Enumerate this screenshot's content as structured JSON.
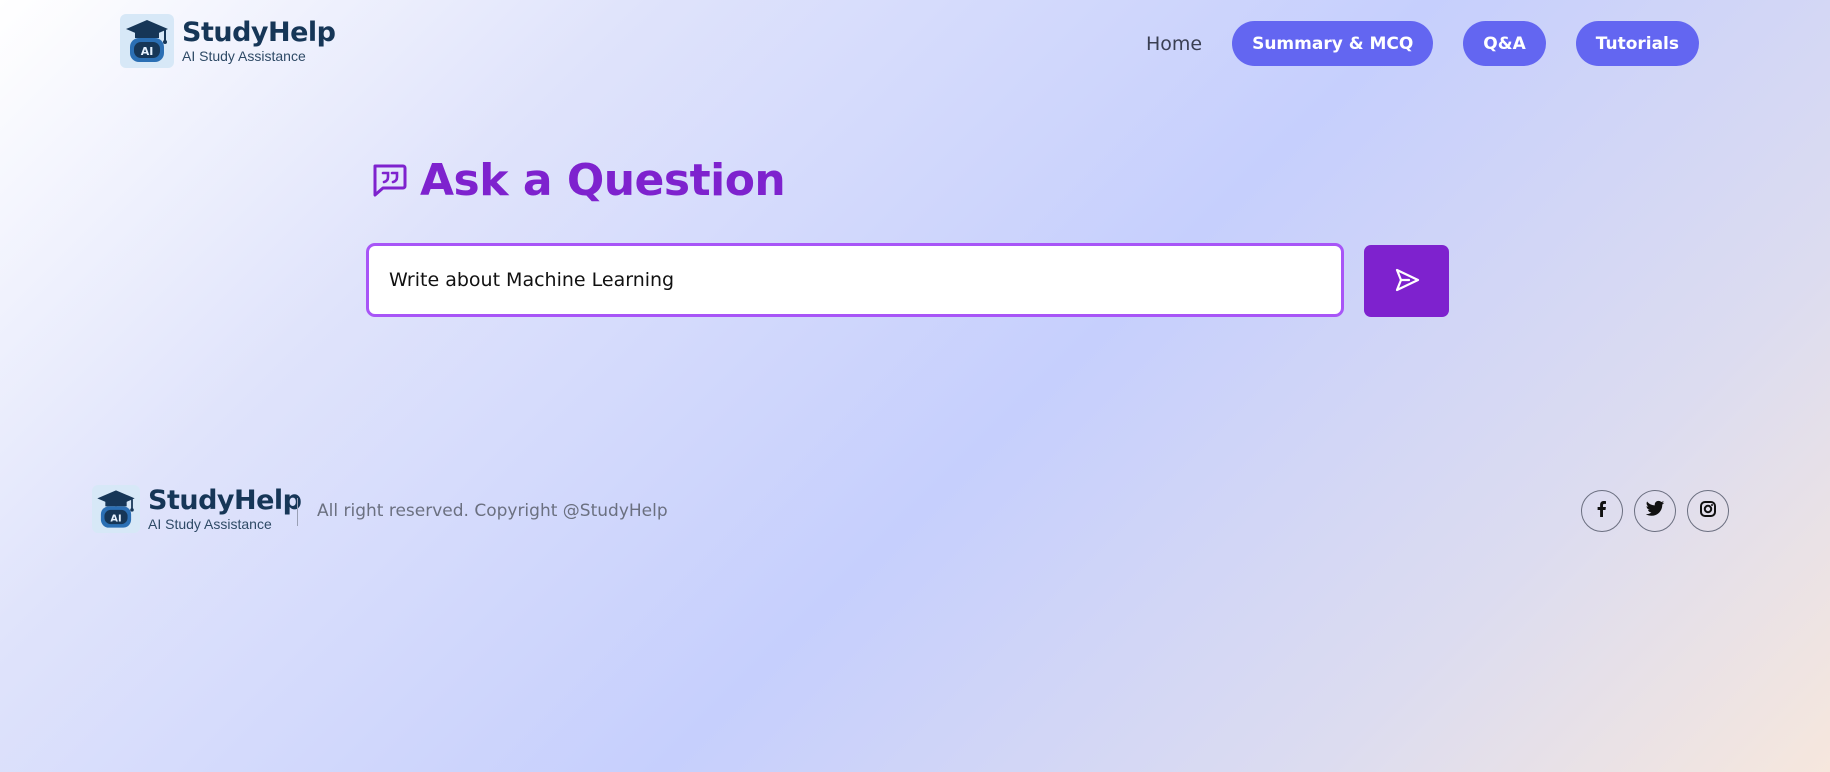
{
  "brand": {
    "name": "StudyHelp",
    "tagline": "AI Study Assistance",
    "badge_text": "AI",
    "icon": "graduation-cap-robot-logo",
    "colors": {
      "name": "#163657",
      "badge_bg": "#d7e8f7"
    }
  },
  "nav": {
    "home": "Home",
    "items": [
      "Summary & MCQ",
      "Q&A",
      "Tutorials"
    ],
    "pill_color": "#6366f1"
  },
  "main": {
    "title": "Ask a Question",
    "title_icon": "chat-quote-icon",
    "input_value": "Write about Machine Learning",
    "send_icon": "send-icon",
    "accent": "#7e22ce",
    "input_border": "#a855f7"
  },
  "footer": {
    "copyright": "All right reserved. Copyright @StudyHelp",
    "social": [
      "facebook-icon",
      "twitter-icon",
      "instagram-icon"
    ]
  }
}
